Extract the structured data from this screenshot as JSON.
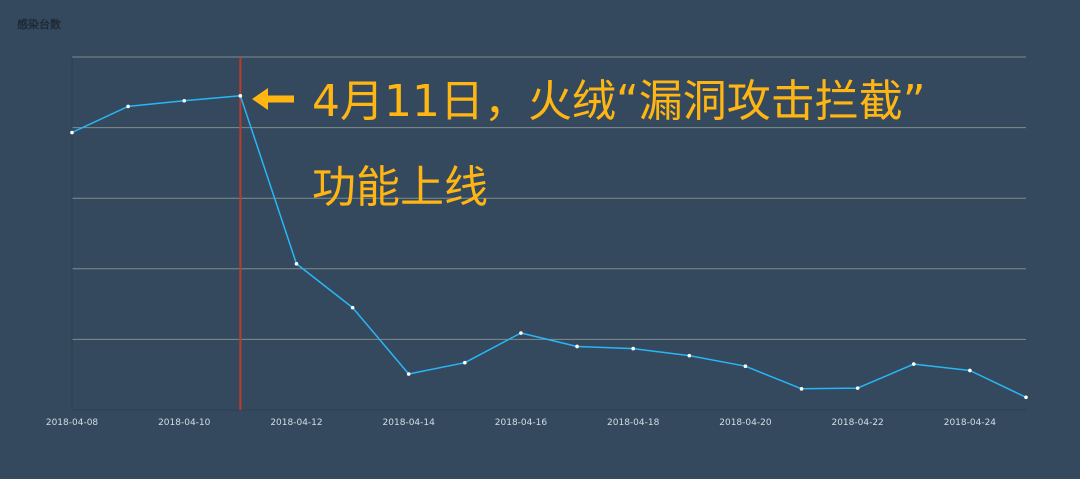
{
  "chart_data": {
    "type": "line",
    "ylabel": "感染台数",
    "x": [
      "2018-04-08",
      "2018-04-09",
      "2018-04-10",
      "2018-04-11",
      "2018-04-12",
      "2018-04-13",
      "2018-04-14",
      "2018-04-15",
      "2018-04-16",
      "2018-04-17",
      "2018-04-18",
      "2018-04-19",
      "2018-04-20",
      "2018-04-21",
      "2018-04-22",
      "2018-04-23",
      "2018-04-24",
      "2018-04-25"
    ],
    "x_tick_labels": [
      "2018-04-08",
      "2018-04-10",
      "2018-04-12",
      "2018-04-14",
      "2018-04-16",
      "2018-04-18",
      "2018-04-20",
      "2018-04-22",
      "2018-04-24"
    ],
    "series": [
      {
        "values": [
          3.93,
          4.3,
          4.38,
          4.45,
          2.07,
          1.45,
          0.51,
          0.67,
          1.09,
          0.9,
          0.87,
          0.77,
          0.62,
          0.3,
          0.31,
          0.65,
          0.56,
          0.18
        ]
      }
    ],
    "ylim": [
      0,
      5
    ],
    "y_tick_labels": [],
    "grid": true,
    "event_marker": {
      "x": "2018-04-11",
      "color": "#c0392b"
    },
    "line_color": "#29b6f6",
    "annotation_color": "#ffb612"
  },
  "annotation": {
    "line1": "4月11日，火绒“漏洞攻击拦截”",
    "line2": "功能上线"
  }
}
